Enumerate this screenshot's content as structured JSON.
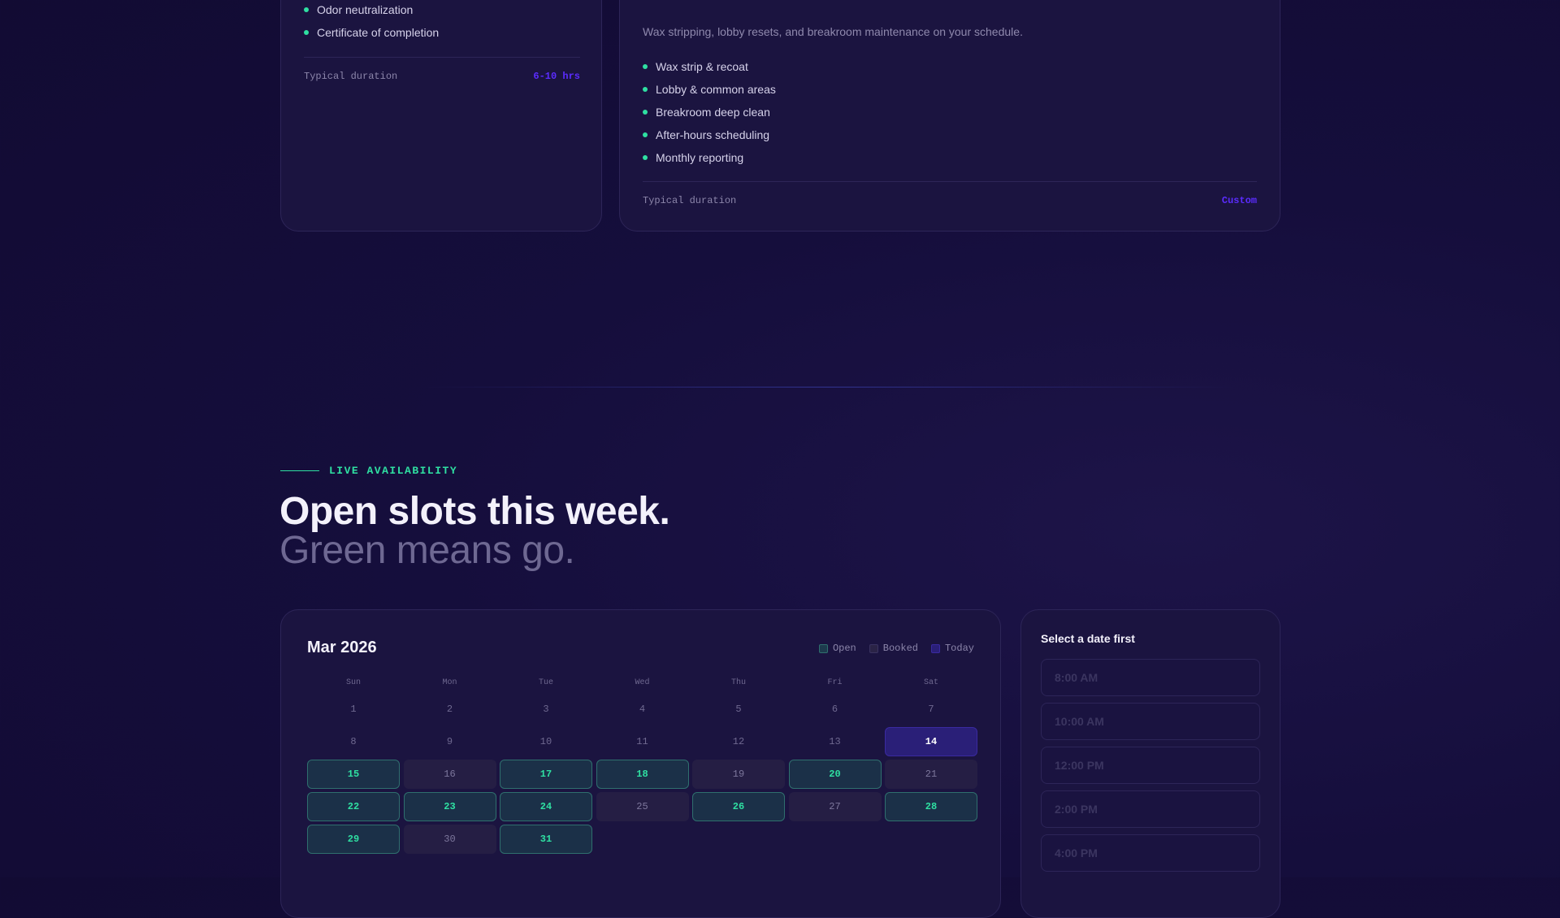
{
  "services": {
    "card_a": {
      "features": [
        "Odor neutralization",
        "Certificate of completion"
      ],
      "duration_label": "Typical duration",
      "duration_value": "6-10 hrs"
    },
    "card_b": {
      "description": "Wax stripping, lobby resets, and breakroom maintenance on your schedule.",
      "features": [
        "Wax strip & recoat",
        "Lobby & common areas",
        "Breakroom deep clean",
        "After-hours scheduling",
        "Monthly reporting"
      ],
      "duration_label": "Typical duration",
      "duration_value": "Custom"
    }
  },
  "availability": {
    "eyebrow": "LIVE AVAILABILITY",
    "title": "Open slots this week.",
    "subtitle": "Green means go."
  },
  "calendar": {
    "month_label": "Mar 2026",
    "legend": {
      "open": "Open",
      "booked": "Booked",
      "today": "Today"
    },
    "weekdays": [
      "Sun",
      "Mon",
      "Tue",
      "Wed",
      "Thu",
      "Fri",
      "Sat"
    ],
    "days": [
      {
        "d": "1",
        "s": "past"
      },
      {
        "d": "2",
        "s": "past"
      },
      {
        "d": "3",
        "s": "past"
      },
      {
        "d": "4",
        "s": "past"
      },
      {
        "d": "5",
        "s": "past"
      },
      {
        "d": "6",
        "s": "past"
      },
      {
        "d": "7",
        "s": "past"
      },
      {
        "d": "8",
        "s": "past"
      },
      {
        "d": "9",
        "s": "past"
      },
      {
        "d": "10",
        "s": "past"
      },
      {
        "d": "11",
        "s": "past"
      },
      {
        "d": "12",
        "s": "past"
      },
      {
        "d": "13",
        "s": "past"
      },
      {
        "d": "14",
        "s": "today"
      },
      {
        "d": "15",
        "s": "open"
      },
      {
        "d": "16",
        "s": "booked"
      },
      {
        "d": "17",
        "s": "open"
      },
      {
        "d": "18",
        "s": "open"
      },
      {
        "d": "19",
        "s": "booked"
      },
      {
        "d": "20",
        "s": "open"
      },
      {
        "d": "21",
        "s": "booked"
      },
      {
        "d": "22",
        "s": "open"
      },
      {
        "d": "23",
        "s": "open"
      },
      {
        "d": "24",
        "s": "open"
      },
      {
        "d": "25",
        "s": "booked"
      },
      {
        "d": "26",
        "s": "open"
      },
      {
        "d": "27",
        "s": "booked"
      },
      {
        "d": "28",
        "s": "open"
      },
      {
        "d": "29",
        "s": "open"
      },
      {
        "d": "30",
        "s": "booked"
      },
      {
        "d": "31",
        "s": "open"
      }
    ]
  },
  "slots": {
    "title": "Select a date first",
    "times": [
      "8:00 AM",
      "10:00 AM",
      "12:00 PM",
      "2:00 PM",
      "4:00 PM"
    ]
  },
  "colors": {
    "accent_green": "#2fe0a2",
    "accent_violet": "#5b2cff",
    "background": "#140d3a"
  }
}
